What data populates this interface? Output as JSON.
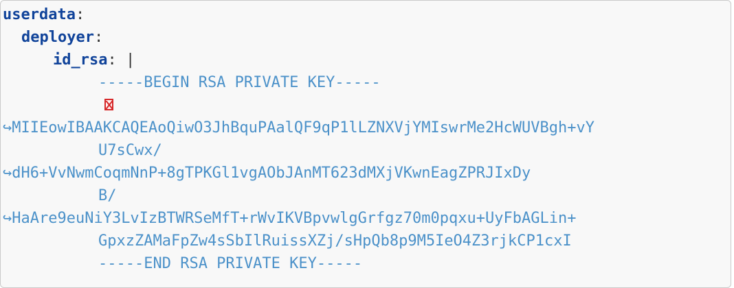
{
  "yaml": {
    "root_key": "userdata",
    "user_key": "deployer",
    "field_key": "id_rsa",
    "block_indicator": "|",
    "begin_marker": "-----BEGIN RSA PRIVATE KEY-----",
    "key_line_1": "MIIEowIBAAKCAQEAoQiwO3JhBquPAalQF9qP1lLZNXVjYMIswrMe2HcWUVBgh+vY",
    "key_line_1_wrap": "U7sCwx/",
    "key_line_2": "dH6+VvNwmCoqmNnP+8gTPKGl1vgAObJAnMT623dMXjVKwnEagZPRJIxDy",
    "key_line_2_wrap": "B/",
    "key_line_3": "HaAre9euNiY3LvIzBTWRSeMfT+rWvIKVBpvwlgGrfgz70m0pqxu+UyFbAGLin+",
    "key_line_3_wrap": "GpxzZAMaFpZw4sSbIlRuissXZj/sHpQb8p9M5IeO4Z3rjkCP1cxI",
    "end_marker": "-----END RSA PRIVATE KEY-----",
    "continuation_arrow": "↪",
    "colon": ":"
  }
}
